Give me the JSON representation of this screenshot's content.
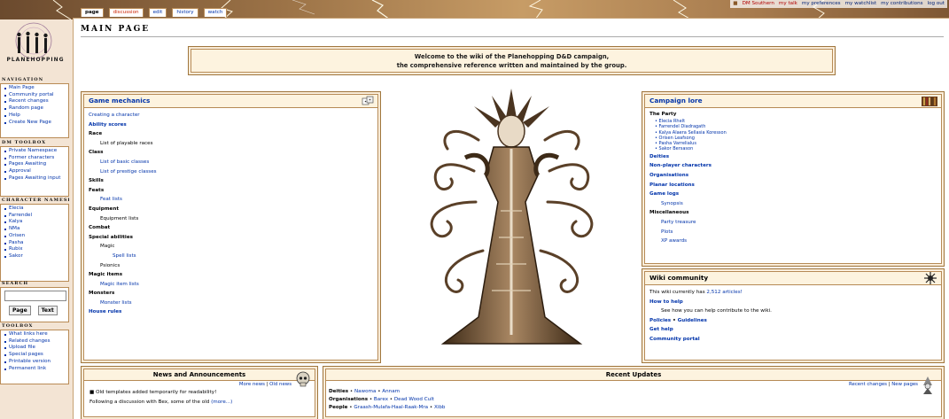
{
  "site_name": "PLANEHOPPING",
  "tabs": [
    {
      "label": "page",
      "selected": true,
      "new": false
    },
    {
      "label": "discussion",
      "selected": false,
      "new": true
    },
    {
      "label": "edit",
      "selected": false,
      "new": false
    },
    {
      "label": "history",
      "selected": false,
      "new": false
    },
    {
      "label": "watch",
      "selected": false,
      "new": false
    }
  ],
  "personal_tools": {
    "user": "DM Southern",
    "items": [
      "my talk",
      "my preferences",
      "my watchlist",
      "my contributions",
      "log out"
    ]
  },
  "sidebar": {
    "navigation": {
      "title": "NAVIGATION",
      "items": [
        "Main Page",
        "Community portal",
        "Recent changes",
        "Random page",
        "Help",
        "Create New Page"
      ]
    },
    "dm_toolbox": {
      "title": "DM TOOLBOX",
      "items": [
        "Private Namespace",
        "Former characters",
        "Pages Awaiting",
        "Approval",
        "Pages Awaiting input"
      ]
    },
    "character_namespaces": {
      "title": "CHARACTER NAMESPACES",
      "items": [
        "Elecia",
        "Farrendel",
        "Kalya",
        "NMa",
        "Orisen",
        "Pasha",
        "Rubix",
        "Sakor"
      ]
    },
    "search": {
      "title": "SEARCH",
      "go_label": "Page",
      "text_label": "Text"
    },
    "toolbox": {
      "title": "TOOLBOX",
      "items": [
        "What links here",
        "Related changes",
        "Upload file",
        "Special pages",
        "Printable version",
        "Permanent link"
      ]
    }
  },
  "page_title": "Main Page",
  "welcome": {
    "line1": "Welcome to the wiki of the Planehopping D&D campaign,",
    "line2": "the comprehensive reference written and maintained by the group."
  },
  "mechanics": {
    "title": "Game mechanics",
    "rows": [
      {
        "text": "Creating a character",
        "level": 0,
        "bold": false,
        "link": true
      },
      {
        "text": "Ability scores",
        "level": 0,
        "bold": true,
        "link": true
      },
      {
        "text": "Race",
        "level": 0,
        "bold": true,
        "link": false
      },
      {
        "text": "List of playable races",
        "level": 1,
        "bold": false,
        "link": false
      },
      {
        "text": "Class",
        "level": 0,
        "bold": true,
        "link": false
      },
      {
        "text": "List of basic classes",
        "level": 1,
        "bold": false,
        "link": true
      },
      {
        "text": "List of prestige classes",
        "level": 1,
        "bold": false,
        "link": true
      },
      {
        "text": "Skills",
        "level": 0,
        "bold": true,
        "link": false
      },
      {
        "text": "Feats",
        "level": 0,
        "bold": true,
        "link": false
      },
      {
        "text": "Feat lists",
        "level": 1,
        "bold": false,
        "link": true
      },
      {
        "text": "Equipment",
        "level": 0,
        "bold": true,
        "link": false
      },
      {
        "text": "Equipment lists",
        "level": 1,
        "bold": false,
        "link": false
      },
      {
        "text": "Combat",
        "level": 0,
        "bold": true,
        "link": false
      },
      {
        "text": "Special abilities",
        "level": 0,
        "bold": true,
        "link": false
      },
      {
        "text": "Magic",
        "level": 1,
        "bold": false,
        "link": false
      },
      {
        "text": "Spell lists",
        "level": 2,
        "bold": false,
        "link": true
      },
      {
        "text": "Psionics",
        "level": 1,
        "bold": false,
        "link": false
      },
      {
        "text": "Magic items",
        "level": 0,
        "bold": true,
        "link": false
      },
      {
        "text": "Magic item lists",
        "level": 1,
        "bold": false,
        "link": true
      },
      {
        "text": "Monsters",
        "level": 0,
        "bold": true,
        "link": false
      },
      {
        "text": "Monster lists",
        "level": 1,
        "bold": false,
        "link": true
      },
      {
        "text": "House rules",
        "level": 0,
        "bold": true,
        "link": true
      }
    ]
  },
  "lore": {
    "title": "Campaign lore",
    "party_heading": "The Party",
    "party": [
      "Elecia Rhelt",
      "Farrendel Diadragath",
      "Kalya Alaera Sellasia Koresson",
      "Orisen Leafsong",
      "Pasha Varrelialus",
      "Sakor Bersason"
    ],
    "rows": [
      {
        "text": "Deities",
        "level": 0,
        "bold": true,
        "link": true
      },
      {
        "text": "Non-player characters",
        "level": 0,
        "bold": true,
        "link": true
      },
      {
        "text": "Organisations",
        "level": 0,
        "bold": true,
        "link": true
      },
      {
        "text": "Planar locations",
        "level": 0,
        "bold": true,
        "link": true
      },
      {
        "text": "Game logs",
        "level": 0,
        "bold": true,
        "link": true
      },
      {
        "text": "Synopsis",
        "level": 1,
        "bold": false,
        "link": true
      },
      {
        "text": "Miscellaneous",
        "level": 0,
        "bold": true,
        "link": false
      },
      {
        "text": "Party treasure",
        "level": 1,
        "bold": false,
        "link": true
      },
      {
        "text": "Plots",
        "level": 1,
        "bold": false,
        "link": true
      },
      {
        "text": "XP awards",
        "level": 1,
        "bold": false,
        "link": true
      }
    ]
  },
  "community": {
    "title": "Wiki community",
    "articles_prefix": "This wiki currently has ",
    "articles_link": "2,512 articles!",
    "how_to_help": "How to help",
    "how_to_help_desc": "See how you can help contribute to the wiki.",
    "policies": "Policies",
    "guidelines": "Guidelines",
    "get_help": "Get help",
    "portal": "Community portal"
  },
  "news": {
    "title": "News and Announcements",
    "more_news": "More news",
    "old_news": "Old news",
    "item1": "Old templates added temporarily for readability!",
    "item2": "Following a discussion with Bex, some of the old",
    "more": "(more...)"
  },
  "recent": {
    "title": "Recent Updates",
    "recent_changes": "Recent changes",
    "new_pages": "New pages",
    "deities_label": "Deities",
    "deities": [
      "Nawoma",
      "Annam"
    ],
    "orgs_label": "Organisations",
    "orgs": [
      "Barex",
      "Dead Wood Cult"
    ],
    "people_label": "People",
    "people": [
      "Graash-Mulafa-Haal-Raak-Mra",
      "Xibb"
    ]
  }
}
